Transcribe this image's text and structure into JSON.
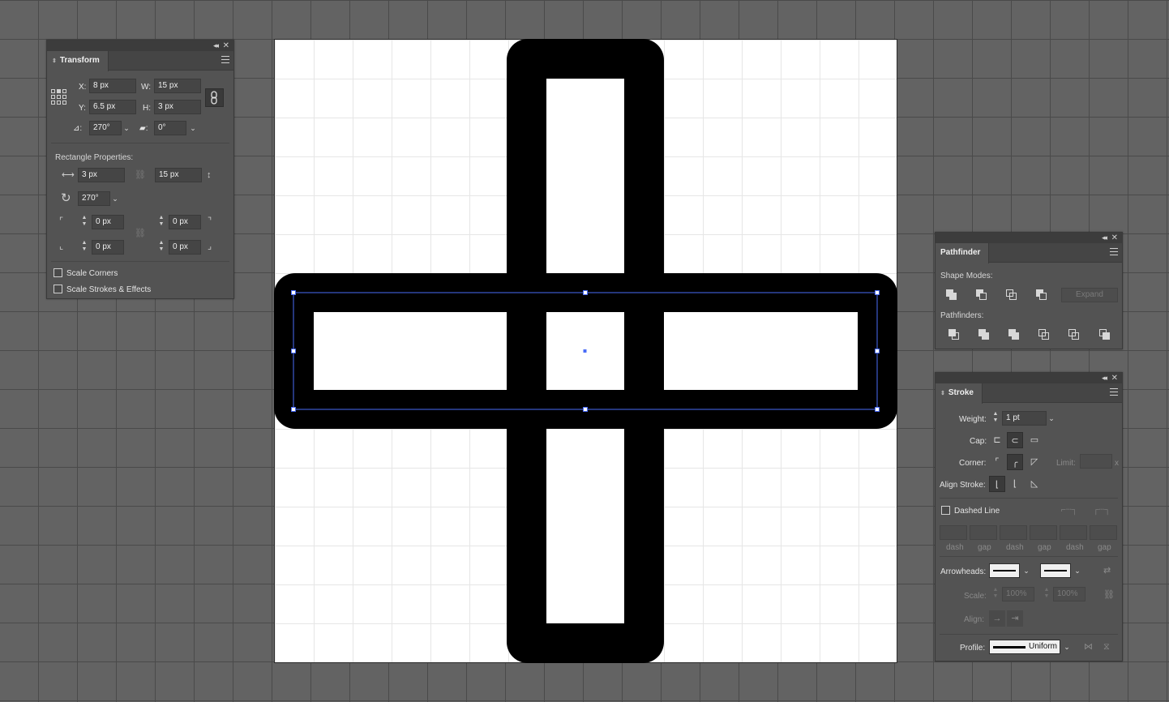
{
  "transform": {
    "tab": "Transform",
    "x_label": "X:",
    "x_value": "8 px",
    "y_label": "Y:",
    "y_value": "6.5 px",
    "w_label": "W:",
    "w_value": "15 px",
    "h_label": "H:",
    "h_value": "3 px",
    "rotate_value": "270°",
    "shear_value": "0°",
    "rect_props_label": "Rectangle Properties:",
    "rect_width": "3 px",
    "rect_height": "15 px",
    "rect_angle": "270°",
    "corner_tl": "0 px",
    "corner_tr": "0 px",
    "corner_bl": "0 px",
    "corner_br": "0 px",
    "scale_corners": "Scale Corners",
    "scale_strokes": "Scale Strokes & Effects"
  },
  "pathfinder": {
    "tab": "Pathfinder",
    "shape_modes_label": "Shape Modes:",
    "expand_label": "Expand",
    "pathfinders_label": "Pathfinders:"
  },
  "stroke": {
    "tab": "Stroke",
    "weight_label": "Weight:",
    "weight_value": "1 pt",
    "cap_label": "Cap:",
    "corner_label": "Corner:",
    "limit_label": "Limit:",
    "limit_suffix": "x",
    "align_label": "Align Stroke:",
    "dashed_label": "Dashed Line",
    "dash_labels": [
      "dash",
      "gap",
      "dash",
      "gap",
      "dash",
      "gap"
    ],
    "arrowheads_label": "Arrowheads:",
    "scale_label": "Scale:",
    "scale_start": "100%",
    "scale_end": "100%",
    "align_arrow_label": "Align:",
    "profile_label": "Profile:",
    "profile_value": "Uniform"
  },
  "colors": {
    "selection": "#4a6cf7",
    "artwork": "#000000"
  }
}
